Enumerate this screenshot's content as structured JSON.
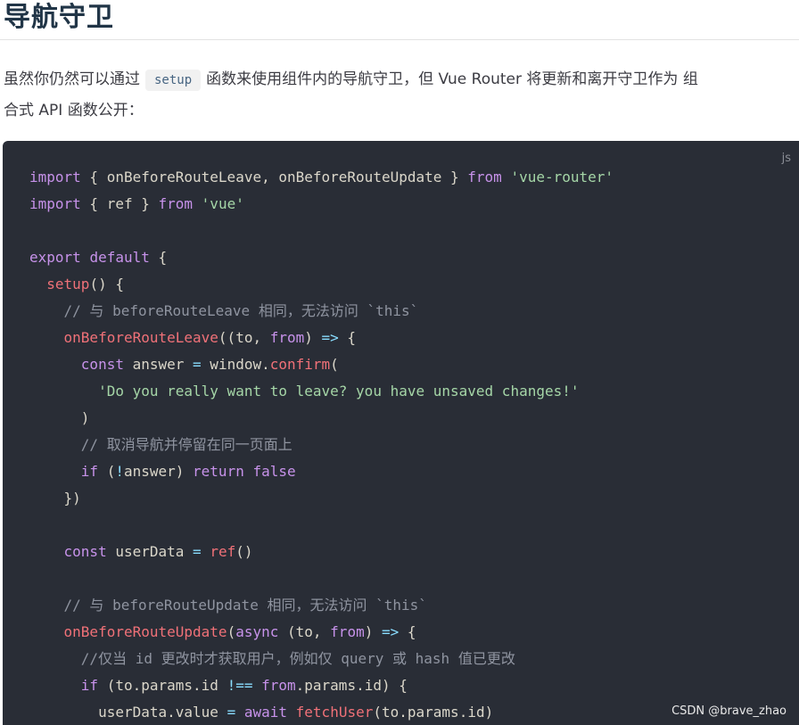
{
  "heading": "导航守卫",
  "paragraph": {
    "before": "虽然你仍然可以通过",
    "code": "setup",
    "after_line1": "函数来使用组件内的导航守卫，但 Vue Router 将更新和离开守卫作为 组",
    "line2": "合式 API 函数公开："
  },
  "code_block": {
    "lang": "js",
    "lines": [
      "import { onBeforeRouteLeave, onBeforeRouteUpdate } from 'vue-router'",
      "import { ref } from 'vue'",
      "",
      "export default {",
      "  setup() {",
      "    // 与 beforeRouteLeave 相同，无法访问 `this`",
      "    onBeforeRouteLeave((to, from) => {",
      "      const answer = window.confirm(",
      "        'Do you really want to leave? you have unsaved changes!'",
      "      )",
      "      // 取消导航并停留在同一页面上",
      "      if (!answer) return false",
      "    })",
      "",
      "    const userData = ref()",
      "",
      "    // 与 beforeRouteUpdate 相同，无法访问 `this`",
      "    onBeforeRouteUpdate(async (to, from) => {",
      "      //仅当 id 更改时才获取用户，例如仅 query 或 hash 值已更改",
      "      if (to.params.id !== from.params.id) {",
      "        userData.value = await fetchUser(to.params.id)"
    ]
  },
  "watermark": "CSDN @brave_zhao",
  "colors": {
    "code_bg": "#292d36",
    "keyword": "#c792ea",
    "string": "#a5d6a7",
    "function": "#f07178",
    "comment": "#8f94a0",
    "operator": "#89ddff",
    "plain": "#dbd7ca"
  }
}
